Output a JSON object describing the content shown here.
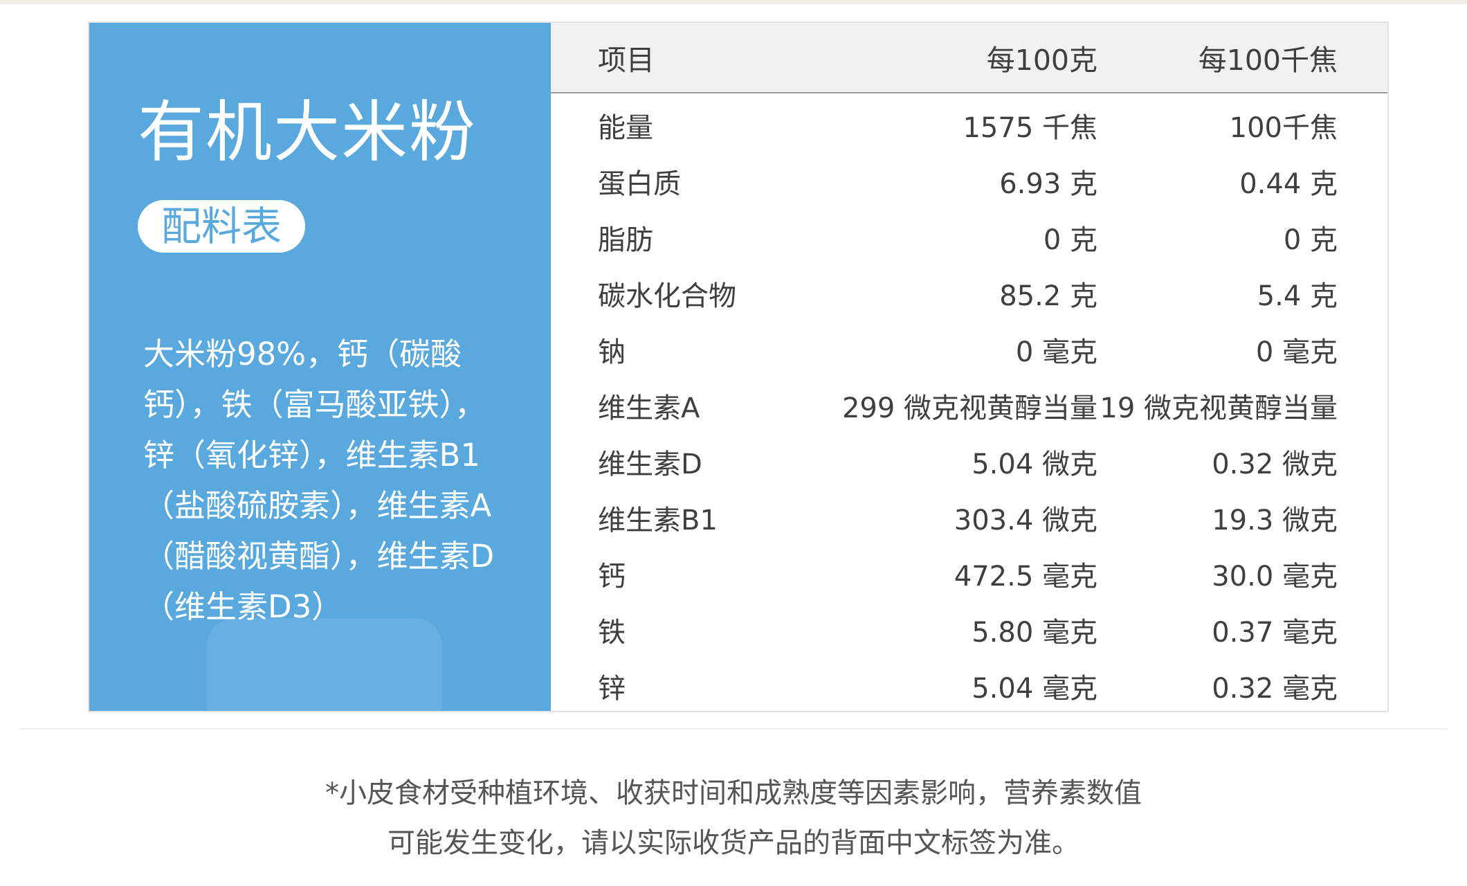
{
  "product": {
    "title": "有机大米粉",
    "badge": "配料表",
    "ingredients": "大米粉98%，钙（碳酸\n钙），铁（富马酸亚铁），\n锌（氧化锌），维生素B1\n（盐酸硫胺素），维生素A\n（醋酸视黄酯），维生素D\n（维生素D3）"
  },
  "table": {
    "headers": [
      "项目",
      "每100克",
      "每100千焦"
    ],
    "rows": [
      [
        "能量",
        "1575 千焦",
        "100千焦"
      ],
      [
        "蛋白质",
        "6.93 克",
        "0.44 克"
      ],
      [
        "脂肪",
        "0 克",
        "0 克"
      ],
      [
        "碳水化合物",
        "85.2 克",
        "5.4 克"
      ],
      [
        "钠",
        "0 毫克",
        "0 毫克"
      ],
      [
        "维生素A",
        "299 微克视黄醇当量",
        "19 微克视黄醇当量"
      ],
      [
        "维生素D",
        "5.04 微克",
        "0.32 微克"
      ],
      [
        "维生素B1",
        "303.4 微克",
        "19.3 微克"
      ],
      [
        "钙",
        "472.5 毫克",
        "30.0 毫克"
      ],
      [
        "铁",
        "5.80 毫克",
        "0.37 毫克"
      ],
      [
        "锌",
        "5.04 毫克",
        "0.32 毫克"
      ]
    ]
  },
  "footnote": {
    "line1": "*小皮食材受种植环境、收获时间和成熟度等因素影响，营养素数值",
    "line2": "可能发生变化，请以实际收货产品的背面中文标签为准。"
  },
  "colors": {
    "panel_blue": "#5aa9de",
    "header_gray": "#f1f1f1",
    "text_dark": "#3f3f3f"
  }
}
